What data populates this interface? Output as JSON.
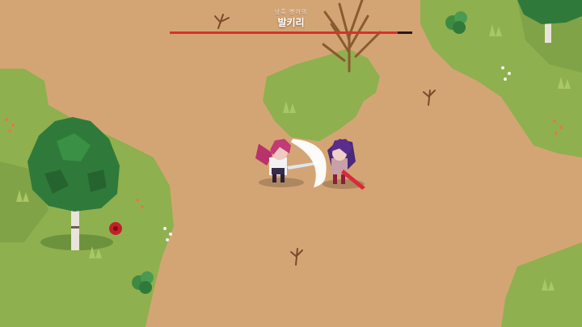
{
  "boss": {
    "subtitle": "낭혹 병어의",
    "name": "발키리",
    "hp_fraction": 0.94
  },
  "colors": {
    "path_dirt": "#d4a574",
    "grass": "#8fb04e",
    "grass_dark": "#6f9440",
    "tree_foliage": "#2f7a3a",
    "hp_fill": "#d9312b",
    "hp_track": "#2a1a14"
  },
  "sprites": {
    "player": "pink-haired-swordswoman",
    "enemy": "purple-haired-valkyrie",
    "effect": "sword-slash-crescent"
  }
}
